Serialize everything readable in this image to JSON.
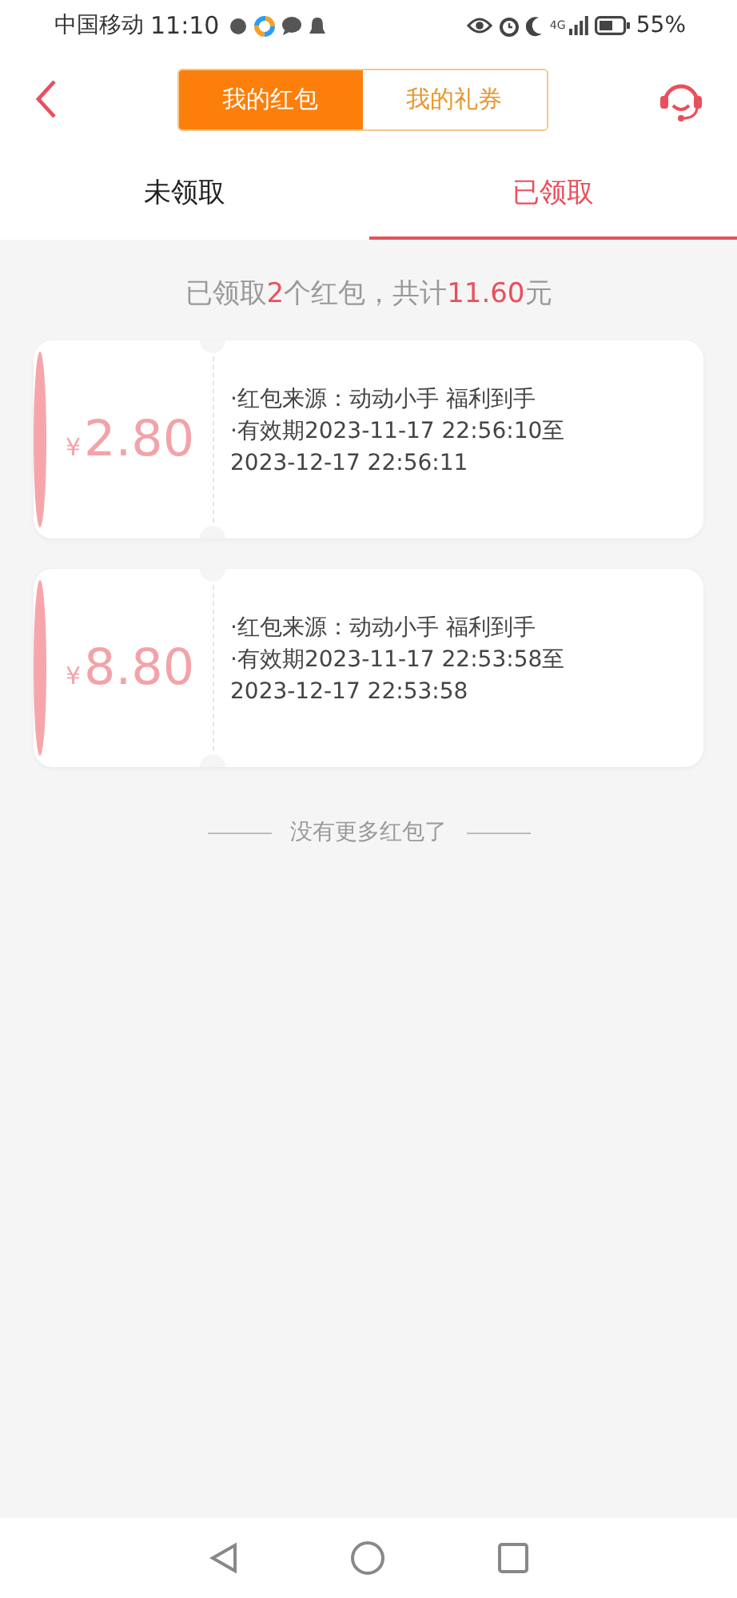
{
  "status_bar": {
    "carrier": "中国移动",
    "time": "11:10",
    "network": "4G",
    "battery": "55%"
  },
  "header": {
    "segments": [
      {
        "label": "我的红包",
        "selected": true
      },
      {
        "label": "我的礼券",
        "selected": false
      }
    ]
  },
  "tabs": [
    {
      "label": "未领取",
      "selected": false
    },
    {
      "label": "已领取",
      "selected": true
    }
  ],
  "summary": [
    {
      "kind": "text",
      "text": "已领取"
    },
    {
      "kind": "highlight",
      "text": "2"
    },
    {
      "kind": "text",
      "text": "个红包，共计"
    },
    {
      "kind": "highlight",
      "text": "11.60"
    },
    {
      "kind": "text",
      "text": "元"
    }
  ],
  "red_packets": [
    {
      "currency": "¥",
      "amount": "2.80",
      "lines": [
        "·红包来源：动动小手 福利到手",
        "·有效期2023-11-17 22:56:10至",
        "2023-12-17 22:56:11"
      ]
    },
    {
      "currency": "¥",
      "amount": "8.80",
      "lines": [
        "·红包来源：动动小手 福利到手",
        "·有效期2023-11-17 22:53:58至",
        "2023-12-17 22:53:58"
      ]
    }
  ],
  "end_note": "没有更多红包了"
}
